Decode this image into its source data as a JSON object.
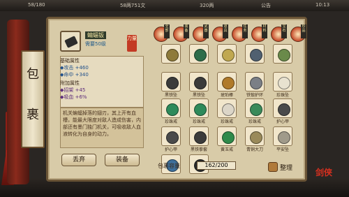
{
  "topbar": {
    "left": "58/180",
    "money": "58两751文",
    "gems": "320两",
    "notice": "公告",
    "time": "10:13"
  },
  "side_label": {
    "char1": "包",
    "char2": "裹"
  },
  "item": {
    "name": "蝙蝠钣",
    "requirement": "需要50级",
    "seal": "力量",
    "base_title": "基础属性",
    "base_stats": [
      "◆攻击 +460",
      "◆命中 +340"
    ],
    "extra_title": "附加属性",
    "extra_stats": [
      "◆招架 +45",
      "◆吸血 +6%"
    ],
    "flavor": "机关蝙蝠掉落的翅刃，其上开有血槽，能最大限度对敌人造成伤害，内部还有墨门独门机关，可吸收敌人血液转化为自身的动力。"
  },
  "buttons": {
    "discard": "丢弃",
    "equip": "装备"
  },
  "bag": {
    "capacity_label": "包裹容量",
    "capacity_value": "162/200",
    "tidy_label": "整理"
  },
  "tabs": [
    "全部",
    "装备",
    "武器",
    "道具",
    "任务",
    "材料",
    "宝石",
    "珍品"
  ],
  "grid_items": [
    {
      "label": "",
      "color": "#8e7a3a"
    },
    {
      "label": "",
      "color": "#2e6d4a"
    },
    {
      "label": "",
      "color": "#c0a850"
    },
    {
      "label": "",
      "color": "#506070"
    },
    {
      "label": "",
      "color": "#6a8a4a"
    },
    {
      "label": "黑铁坠",
      "color": "#3b3b3b"
    },
    {
      "label": "黑铁坠",
      "color": "#3b3b3b"
    },
    {
      "label": "琥珀棒",
      "color": "#b07a2a"
    },
    {
      "label": "铁锻护环",
      "color": "#7b7f86"
    },
    {
      "label": "珍珠坠",
      "color": "#e8e2d0"
    },
    {
      "label": "珍珠戒",
      "color": "#2e8a5a"
    },
    {
      "label": "珍珠戒",
      "color": "#2e8a5a"
    },
    {
      "label": "珍珠戒",
      "color": "#dcd6c8"
    },
    {
      "label": "珍珠戒",
      "color": "#3a8a5a"
    },
    {
      "label": "护心甲",
      "color": "#4a4a4a"
    },
    {
      "label": "护心甲",
      "color": "#4a4a4a"
    },
    {
      "label": "黑铁拳套",
      "color": "#3b3b3b"
    },
    {
      "label": "黄玉戒",
      "color": "#2f8a4a"
    },
    {
      "label": "青铜大刀",
      "color": "#9a8a5a"
    },
    {
      "label": "平安坠",
      "color": "#a09a8a"
    },
    {
      "label": "",
      "color": "#3d6f9b"
    },
    {
      "label": "",
      "color": "#2b2b2b"
    }
  ],
  "logo": "剑侠"
}
